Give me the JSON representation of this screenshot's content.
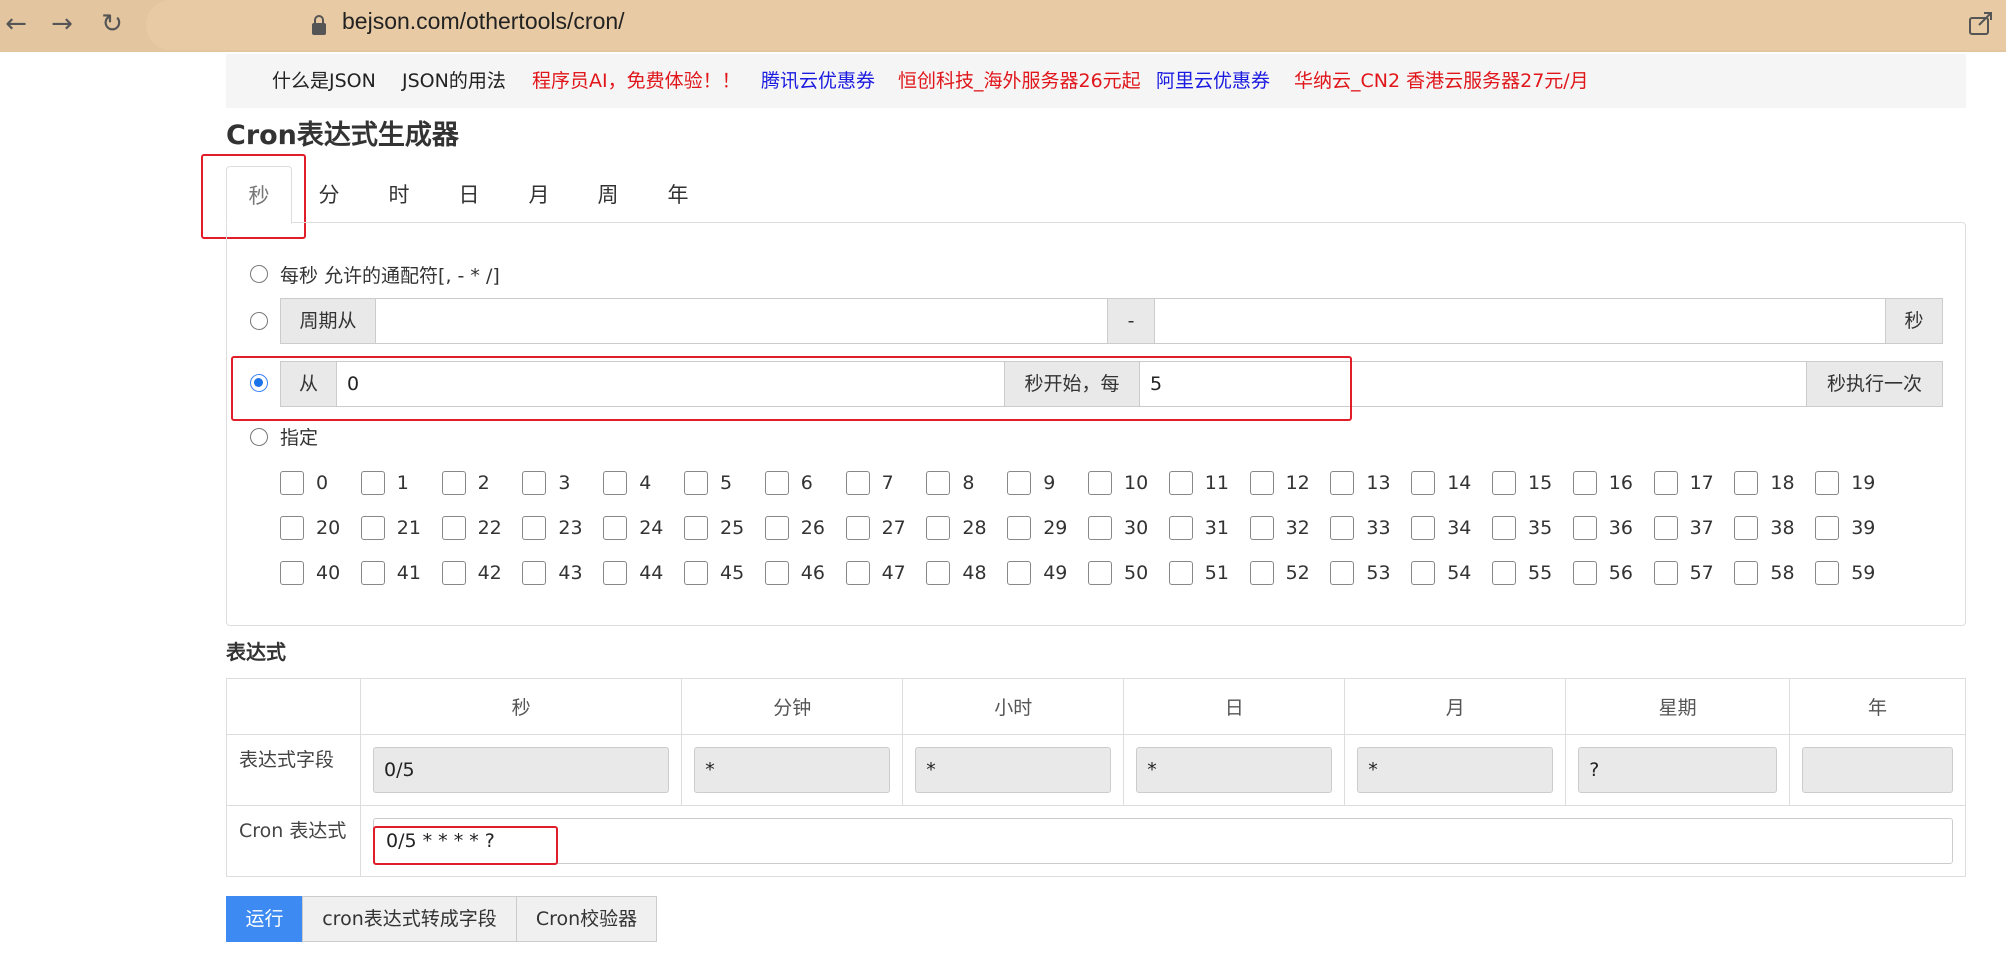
{
  "browser": {
    "url": "bejson.com/othertools/cron/"
  },
  "topnav": {
    "links": [
      {
        "label": "什么是JSON",
        "color": "#222222"
      },
      {
        "label": "JSON的用法",
        "color": "#222222"
      },
      {
        "label": "程序员AI，免费体验！！",
        "color": "#e0161b"
      },
      {
        "label": "腾讯云优惠券",
        "color": "#1a1ae0"
      },
      {
        "label": "恒创科技_海外服务器26元起",
        "color": "#e0161b"
      },
      {
        "label": "阿里云优惠券",
        "color": "#1a1ae0"
      },
      {
        "label": "华纳云_CN2 香港云服务器27元/月",
        "color": "#e0161b"
      }
    ]
  },
  "page": {
    "title": "Cron表达式生成器"
  },
  "tabs": [
    "秒",
    "分",
    "时",
    "日",
    "月",
    "周",
    "年"
  ],
  "seconds_panel": {
    "every_label": "每秒 允许的通配符[, - * /]",
    "period": {
      "prefix": "周期从",
      "separator": "-",
      "suffix": "秒",
      "from_value": "",
      "to_value": ""
    },
    "step": {
      "prefix": "从",
      "start_value": "0",
      "middle": "秒开始，每",
      "interval_value": "5",
      "suffix": "秒执行一次"
    },
    "specify_label": "指定",
    "selected_option": "step"
  },
  "expression": {
    "heading": "表达式",
    "columns": [
      "秒",
      "分钟",
      "小时",
      "日",
      "月",
      "星期",
      "年"
    ],
    "field_row_label": "表达式字段",
    "field_values": [
      "0/5",
      "*",
      "*",
      "*",
      "*",
      "?",
      ""
    ],
    "cron_row_label": "Cron 表达式",
    "cron_value": "0/5 * * * * ?"
  },
  "buttons": {
    "run": "运行",
    "to_fields": "cron表达式转成字段",
    "validator": "Cron校验器"
  },
  "colors": {
    "highlight": "#e11d2a",
    "primary": "#3d8bf2"
  }
}
